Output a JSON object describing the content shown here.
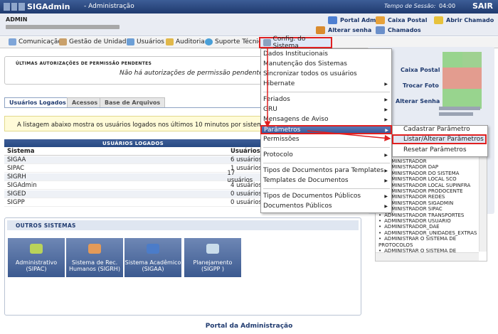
{
  "header": {
    "app_name": "SIGAdmin",
    "subtitle": "- Administração",
    "session_label": "Tempo de Sessão:",
    "session_time": "04:00",
    "logout": "SAIR"
  },
  "user": {
    "name": "ADMIN"
  },
  "quick_links": {
    "portal_admin": "Portal Admin",
    "caixa_postal": "Caixa Postal",
    "abrir_chamado": "Abrir Chamado",
    "alterar_senha": "Alterar senha",
    "chamados": "Chamados"
  },
  "menu": {
    "comunicacao": "Comunicação",
    "gestao_unidades": "Gestão de Unidades",
    "usuarios": "Usuários",
    "auditoria": "Auditoria",
    "suporte": "Suporte Técnico",
    "config": "Config. do Sistema"
  },
  "pending": {
    "title": "Últimas autorizações de permissão pendentes",
    "message": "Não há autorizações de permissão pendentes."
  },
  "tabs": [
    "Usuários Logados",
    "Acessos",
    "Base de Arquivos"
  ],
  "logged": {
    "info": "A listagem abaixo mostra os usuários logados nos últimos 10 minutos por sistema.",
    "header": "Usuários Logados",
    "col_sistema": "Sistema",
    "col_usuarios": "Usuários",
    "rows": [
      {
        "sistema": "SIGAA",
        "usuarios": "6 usuários"
      },
      {
        "sistema": "SIPAC",
        "usuarios": "1 usuários"
      },
      {
        "sistema": "SIGRH",
        "usuarios": "17 usuários"
      },
      {
        "sistema": "SIGAdmin",
        "usuarios": "4 usuários"
      },
      {
        "sistema": "SIGED",
        "usuarios": "0 usuários"
      },
      {
        "sistema": "SIGPP",
        "usuarios": "0 usuários"
      }
    ]
  },
  "outros": {
    "title": "Outros Sistemas",
    "systems": [
      {
        "line1": "Administrativo",
        "line2": "(SIPAC)"
      },
      {
        "line1": "Sistema de Rec.",
        "line2": "Humanos (SIGRH)"
      },
      {
        "line1": "Sistema Acadêmico",
        "line2": "(SIGAA)"
      },
      {
        "line1": "Planejamento",
        "line2": "(SIGPP )"
      }
    ]
  },
  "sidebar": {
    "caixa_postal": "Caixa Postal",
    "trocar_foto": "Trocar Foto",
    "alterar_senha": "Alterar Senha"
  },
  "roles": [
    "ADMINISTRADOR",
    "ADMINISTRADOR DAP",
    "ADMINISTRADOR DO SISTEMA",
    "ADMINISTRADOR LOCAL SCO",
    "ADMINISTRADOR LOCAL SUPINFRA",
    "ADMINISTRADOR PRODOCENTE",
    "ADMINISTRADOR REDES",
    "ADMINISTRADOR SIGADMIN",
    "ADMINISTRADOR SIPAC",
    "ADMINISTRADOR TRANSPORTES",
    "ADMINISTRADOR USUARIO",
    "ADMINISTRADOR_DAE",
    "ADMINISTRADOR_UNIDADES_EXTRAS",
    "ADMINISTRAR O SISTEMA DE PROTOCOLOS",
    "ADMINISTRAR O SISTEMA DE"
  ],
  "config_menu": {
    "dados": "Dados Institucionais",
    "manutencao": "Manutenção dos Sistemas",
    "sincronizar": "Sincronizar todos os usuários",
    "hibernate": "Hibernate",
    "feriados": "Feriados",
    "gru": "GRU",
    "mensagens": "Mensagens de Aviso",
    "parametros": "Parâmetros",
    "permissoes": "Permissões",
    "protocolo": "Protocolo",
    "tipos_docs": "Tipos de Documentos para Templates",
    "templates": "Templates de Documentos",
    "tipos_publicos": "Tipos de Documentos Públicos",
    "docs_publicos": "Documentos Públicos"
  },
  "params_submenu": {
    "cadastrar": "Cadastrar Parâmetro",
    "listar": "Listar/Alterar Parâmetros",
    "resetar": "Resetar Parâmetros"
  },
  "footer": "Portal da Administração",
  "colors": {
    "header": "#2b4a80",
    "highlight": "#e02020"
  }
}
